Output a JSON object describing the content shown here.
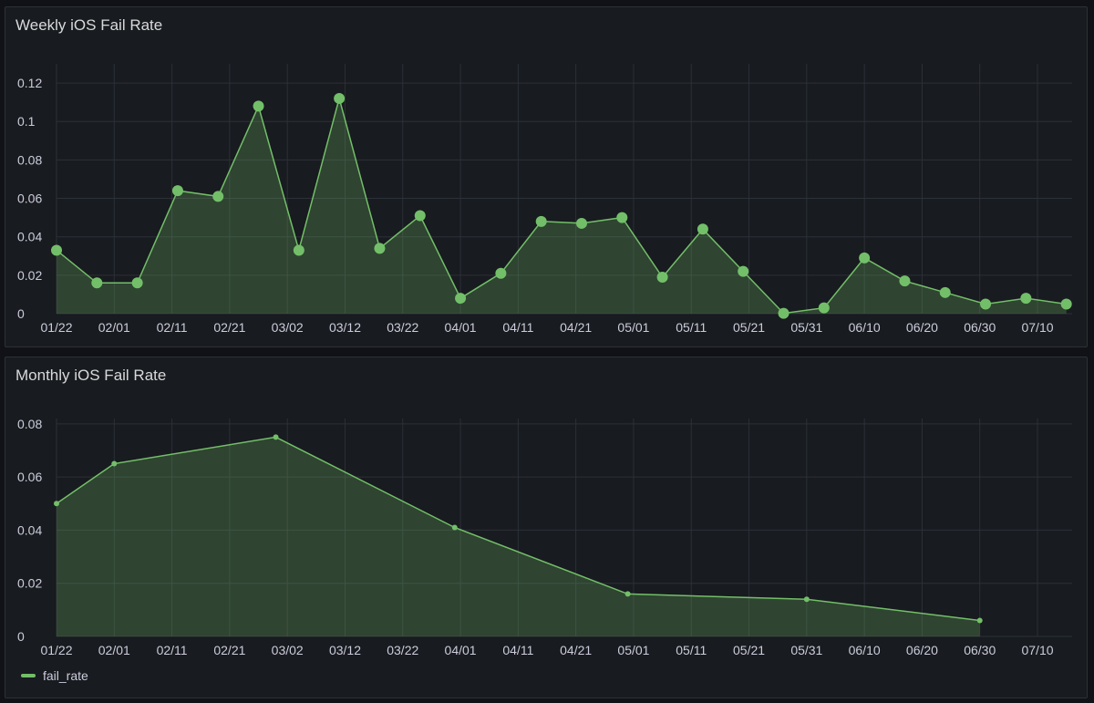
{
  "theme": {
    "series_color": "#73bf69",
    "fill_color": "rgba(115,191,105,0.25)"
  },
  "panels": {
    "weekly": {
      "title": "Weekly iOS Fail Rate"
    },
    "monthly": {
      "title": "Monthly iOS Fail Rate"
    }
  },
  "legend": {
    "label": "fail_rate"
  },
  "chart_data": [
    {
      "type": "area",
      "title": "Weekly iOS Fail Rate",
      "xlabel": "",
      "ylabel": "",
      "x_ticks": [
        "01/22",
        "02/01",
        "02/11",
        "02/21",
        "03/02",
        "03/12",
        "03/22",
        "04/01",
        "04/11",
        "04/21",
        "05/01",
        "05/11",
        "05/21",
        "05/31",
        "06/10",
        "06/20",
        "06/30",
        "07/10"
      ],
      "x_tick_days": [
        0,
        10,
        20,
        30,
        40,
        50,
        60,
        70,
        80,
        90,
        100,
        110,
        120,
        130,
        140,
        150,
        160,
        170
      ],
      "y_ticks": [
        0,
        0.02,
        0.04,
        0.06,
        0.08,
        0.1,
        0.12
      ],
      "y_tick_labels": [
        "0",
        "0.02",
        "0.04",
        "0.06",
        "0.08",
        "0.1",
        "0.12"
      ],
      "xlim_days": [
        0,
        176
      ],
      "ylim": [
        0,
        0.13
      ],
      "grid": true,
      "series": [
        {
          "name": "fail_rate",
          "x": [
            "01/22",
            "01/29",
            "02/05",
            "02/12",
            "02/19",
            "02/26",
            "03/05",
            "03/12",
            "03/19",
            "03/26",
            "04/02",
            "04/09",
            "04/16",
            "04/23",
            "04/30",
            "05/07",
            "05/14",
            "05/21",
            "05/28",
            "06/04",
            "06/11",
            "06/18",
            "06/25",
            "07/02",
            "07/09",
            "07/16"
          ],
          "x_days": [
            0,
            7,
            14,
            21,
            28,
            35,
            42,
            49,
            56,
            63,
            70,
            77,
            84,
            91,
            98,
            105,
            112,
            119,
            126,
            133,
            140,
            147,
            154,
            161,
            168,
            175
          ],
          "values": [
            0.033,
            0.016,
            0.016,
            0.064,
            0.061,
            0.108,
            0.033,
            0.112,
            0.034,
            0.051,
            0.008,
            0.021,
            0.048,
            0.047,
            0.05,
            0.019,
            0.044,
            0.022,
            0.0002,
            0.003,
            0.029,
            0.017,
            0.011,
            0.005,
            0.008,
            0.005
          ]
        }
      ]
    },
    {
      "type": "area",
      "title": "Monthly iOS Fail Rate",
      "xlabel": "",
      "ylabel": "",
      "x_ticks": [
        "01/22",
        "02/01",
        "02/11",
        "02/21",
        "03/02",
        "03/12",
        "03/22",
        "04/01",
        "04/11",
        "04/21",
        "05/01",
        "05/11",
        "05/21",
        "05/31",
        "06/10",
        "06/20",
        "06/30",
        "07/10"
      ],
      "x_tick_days": [
        0,
        10,
        20,
        30,
        40,
        50,
        60,
        70,
        80,
        90,
        100,
        110,
        120,
        130,
        140,
        150,
        160,
        170
      ],
      "y_ticks": [
        0,
        0.02,
        0.04,
        0.06,
        0.08
      ],
      "y_tick_labels": [
        "0",
        "0.02",
        "0.04",
        "0.06",
        "0.08"
      ],
      "xlim_days": [
        0,
        176
      ],
      "ylim": [
        0,
        0.082
      ],
      "grid": true,
      "legend": "bottom-left",
      "series": [
        {
          "name": "fail_rate",
          "x": [
            "01/22",
            "02/01",
            "03/01",
            "04/01",
            "05/01",
            "06/01",
            "06/30"
          ],
          "x_days": [
            0,
            10,
            38,
            69,
            99,
            130,
            160
          ],
          "values": [
            0.05,
            0.065,
            0.075,
            0.041,
            0.016,
            0.014,
            0.006
          ]
        }
      ]
    }
  ]
}
